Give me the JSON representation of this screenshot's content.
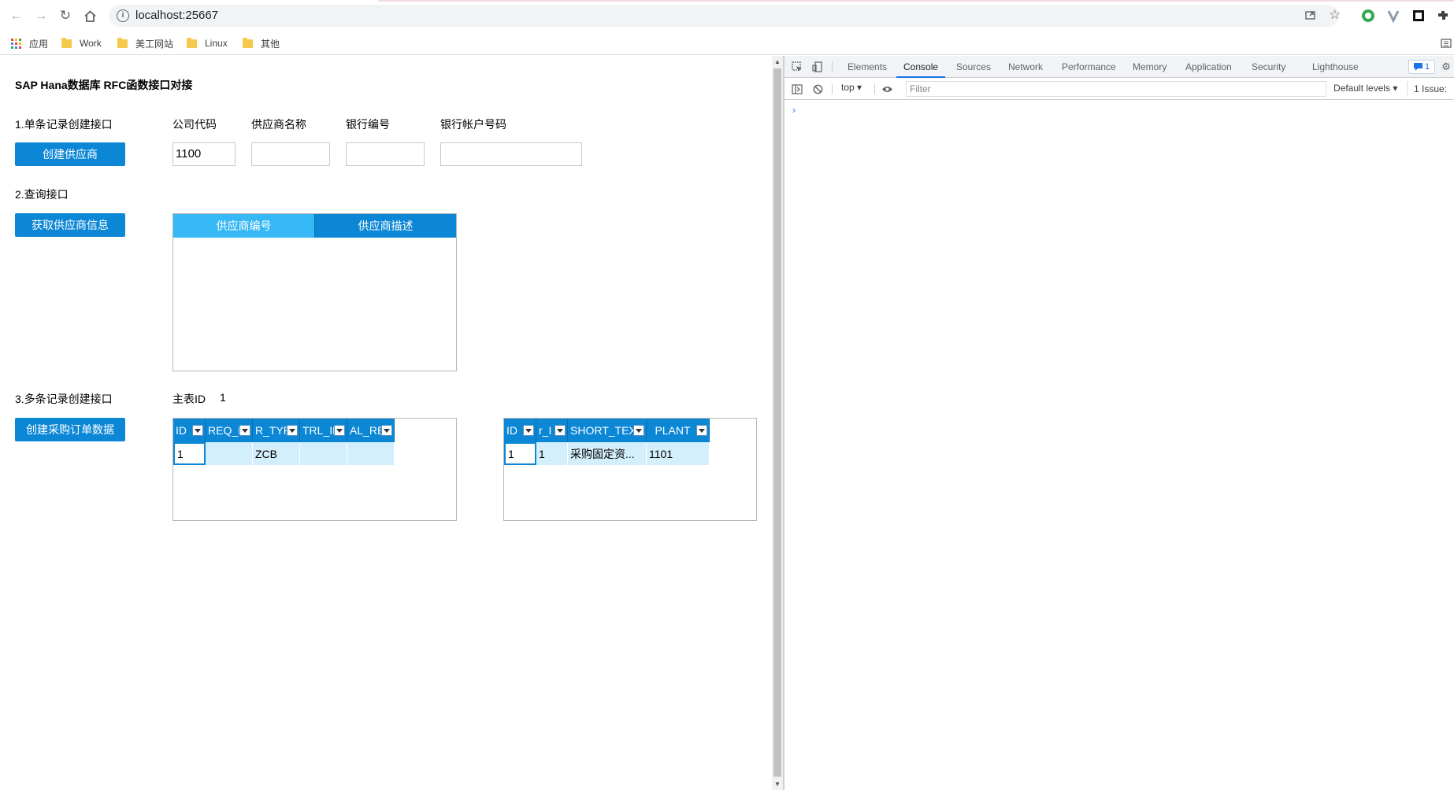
{
  "browser": {
    "url": "localhost:25667",
    "bookmarks": [
      {
        "label": "应用",
        "kind": "apps"
      },
      {
        "label": "Work",
        "kind": "folder"
      },
      {
        "label": "美工网站",
        "kind": "folder"
      },
      {
        "label": "Linux",
        "kind": "folder"
      },
      {
        "label": "其他",
        "kind": "folder"
      }
    ]
  },
  "page": {
    "title": "SAP Hana数据库 RFC函数接口对接",
    "section1": {
      "label": "1.单条记录创建接口",
      "button": "创建供应商",
      "fields": [
        {
          "label": "公司代码",
          "value": "1100"
        },
        {
          "label": "供应商名称",
          "value": ""
        },
        {
          "label": "银行编号",
          "value": ""
        },
        {
          "label": "银行帐户号码",
          "value": ""
        }
      ]
    },
    "section2": {
      "label": "2.查询接口",
      "button": "获取供应商信息",
      "columns": [
        "供应商编号",
        "供应商描述"
      ]
    },
    "section3": {
      "label": "3.多条记录创建接口",
      "button": "创建采购订单数据",
      "master_id_label": "主表ID",
      "master_id_value": "1",
      "grid1": {
        "columns": [
          "ID",
          "REQ_N",
          "R_TYP",
          "TRL_IN",
          "AL_RE"
        ],
        "row": [
          "1",
          "",
          "ZCB",
          "",
          ""
        ]
      },
      "grid2": {
        "columns": [
          "ID",
          "r_I",
          "SHORT_TEXT",
          "PLANT"
        ],
        "row": [
          "1",
          "1",
          "采购固定资...",
          "1101"
        ]
      }
    }
  },
  "devtools": {
    "tabs": [
      "Elements",
      "Console",
      "Sources",
      "Network",
      "Performance",
      "Memory",
      "Application",
      "Security",
      "Lighthouse"
    ],
    "active_tab": "Console",
    "message_badge": "1",
    "context": "top",
    "filter_placeholder": "Filter",
    "levels": "Default levels",
    "issues": "1 Issue:",
    "prompt": "›"
  }
}
